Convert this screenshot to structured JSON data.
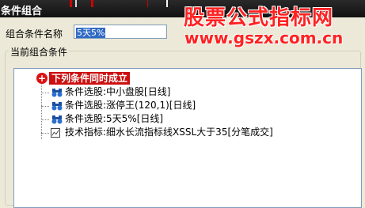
{
  "window": {
    "title": "条件组合"
  },
  "watermark": {
    "line1": "股票公式指标网",
    "line2": "www.gszx.com.cn"
  },
  "form": {
    "name_label": "组合条件名称",
    "name_value": "5天5%"
  },
  "group": {
    "label": "当前组合条件"
  },
  "tree": {
    "root": {
      "label": "下列条件同时成立"
    },
    "items": [
      {
        "icon": "binoculars-icon",
        "label": "条件选股:中小盘股[日线]"
      },
      {
        "icon": "binoculars-icon",
        "label": "条件选股:涨停王(120,1)[日线]"
      },
      {
        "icon": "binoculars-icon",
        "label": "条件选股:5天5%[日线]"
      },
      {
        "icon": "chart-icon",
        "label": "技术指标:细水长流指标线XSSL大于35[分笔成交]"
      }
    ]
  },
  "colors": {
    "accent": "#cc1111",
    "selection": "#316ac5",
    "watermark": "#ff2222"
  }
}
